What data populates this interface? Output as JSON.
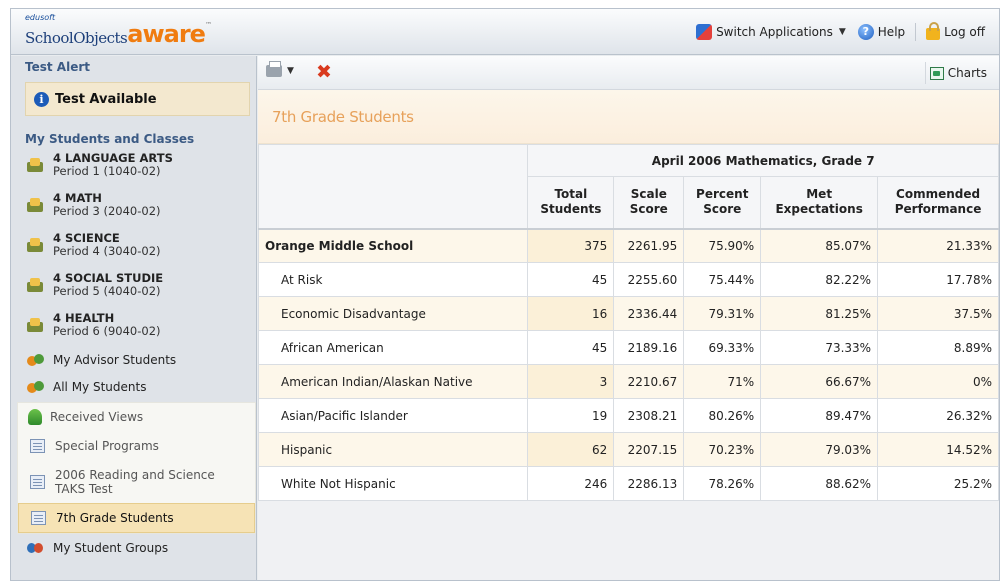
{
  "app": {
    "logo_prefix": "edusoft",
    "logo_main": "SchoolObjects",
    "logo_brand": "aware",
    "logo_tm": "™"
  },
  "topnav": {
    "switch_label": "Switch Applications",
    "help_label": "Help",
    "logoff_label": "Log off"
  },
  "sidebar": {
    "test_alert_header": "Test Alert",
    "test_available": "Test Available",
    "students_header": "My Students and Classes",
    "classes": [
      {
        "name": "4 LANGUAGE ARTS",
        "period": "Period 1 (1040-02)"
      },
      {
        "name": "4 MATH",
        "period": "Period 3 (2040-02)"
      },
      {
        "name": "4 SCIENCE",
        "period": "Period 4 (3040-02)"
      },
      {
        "name": "4 SOCIAL STUDIE",
        "period": "Period 5 (4040-02)"
      },
      {
        "name": "4 HEALTH",
        "period": "Period 6 (9040-02)"
      }
    ],
    "advisor": "My Advisor Students",
    "all_students": "All My Students",
    "received_views": "Received Views",
    "views": [
      "Special Programs",
      "2006 Reading and Science TAKS Test",
      "7th Grade Students"
    ],
    "groups": "My Student Groups"
  },
  "toolbar": {
    "charts_label": "Charts"
  },
  "main": {
    "title": "7th Grade Students",
    "table": {
      "group_header": "April 2006 Mathematics, Grade 7",
      "columns": [
        {
          "l1": "Total",
          "l2": "Students"
        },
        {
          "l1": "Scale",
          "l2": "Score"
        },
        {
          "l1": "Percent",
          "l2": "Score"
        },
        {
          "l1": "Met",
          "l2": "Expectations"
        },
        {
          "l1": "Commended",
          "l2": "Performance"
        }
      ],
      "rows": [
        {
          "label": "Orange Middle School",
          "total": "375",
          "scale": "2261.95",
          "percent": "75.90%",
          "met": "85.07%",
          "commended": "21.33%"
        },
        {
          "label": "At Risk",
          "total": "45",
          "scale": "2255.60",
          "percent": "75.44%",
          "met": "82.22%",
          "commended": "17.78%"
        },
        {
          "label": "Economic Disadvantage",
          "total": "16",
          "scale": "2336.44",
          "percent": "79.31%",
          "met": "81.25%",
          "commended": "37.5%"
        },
        {
          "label": "African American",
          "total": "45",
          "scale": "2189.16",
          "percent": "69.33%",
          "met": "73.33%",
          "commended": "8.89%"
        },
        {
          "label": "American Indian/Alaskan Native",
          "total": "3",
          "scale": "2210.67",
          "percent": "71%",
          "met": "66.67%",
          "commended": "0%"
        },
        {
          "label": "Asian/Pacific Islander",
          "total": "19",
          "scale": "2308.21",
          "percent": "80.26%",
          "met": "89.47%",
          "commended": "26.32%"
        },
        {
          "label": "Hispanic",
          "total": "62",
          "scale": "2207.15",
          "percent": "70.23%",
          "met": "79.03%",
          "commended": "14.52%"
        },
        {
          "label": "White Not Hispanic",
          "total": "246",
          "scale": "2286.13",
          "percent": "78.26%",
          "met": "88.62%",
          "commended": "25.2%"
        }
      ]
    }
  }
}
